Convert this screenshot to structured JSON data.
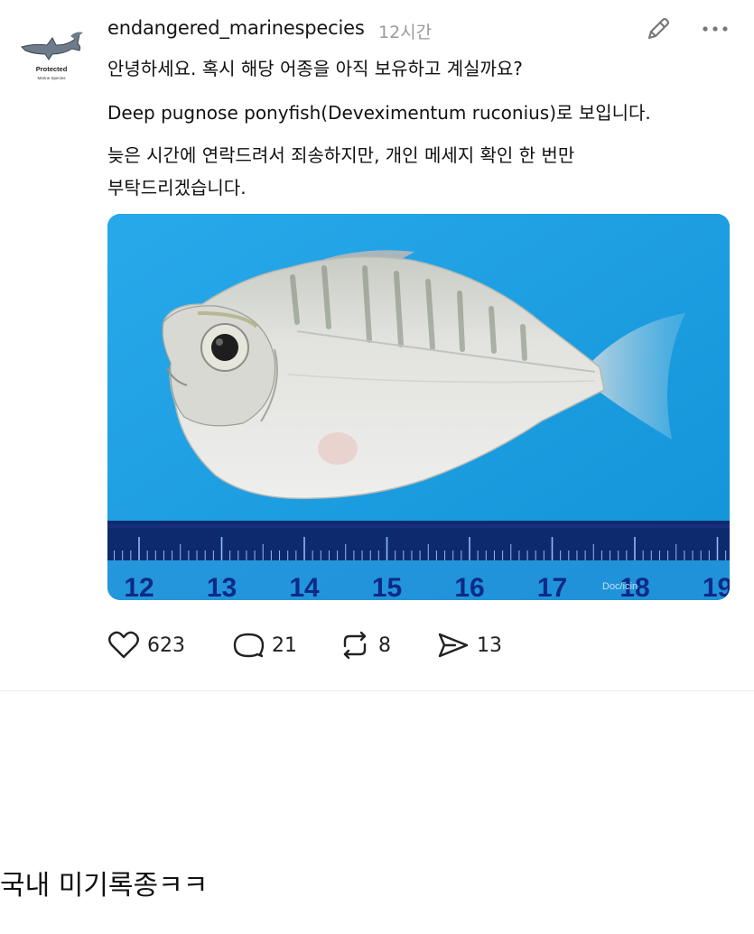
{
  "post": {
    "username": "endangered_marinespecies",
    "time": "12시간",
    "avatar_text_line1": "Protected",
    "avatar_text_line2": "Marine Species",
    "lines": [
      "안녕하세요. 혹시 해당 어종을 아직 보유하고 계실까요?",
      "Deep pugnose ponyfish(Deveximentum ruconius)로 보입니다.",
      "늦은 시간에 연락드려서 죄송하지만, 개인 메세지 확인 한 번만",
      "부탁드리겠습니다."
    ],
    "image": {
      "ruler_numbers": [
        "12",
        "13",
        "14",
        "15",
        "16",
        "17",
        "18",
        "19"
      ],
      "watermark": "Doc/icin"
    },
    "stats": {
      "likes": "623",
      "replies": "21",
      "reposts": "8",
      "shares": "13"
    }
  },
  "comment": {
    "text": "국내 미기록종ㅋㅋ"
  },
  "colors": {
    "photo_background": "#1b9fe4",
    "ruler": "#0d2a6e",
    "fish_body": "#d9dbd8"
  },
  "icons": [
    "shark-icon",
    "pencil-icon",
    "more-icon",
    "heart-icon",
    "comment-icon",
    "repost-icon",
    "share-icon"
  ]
}
